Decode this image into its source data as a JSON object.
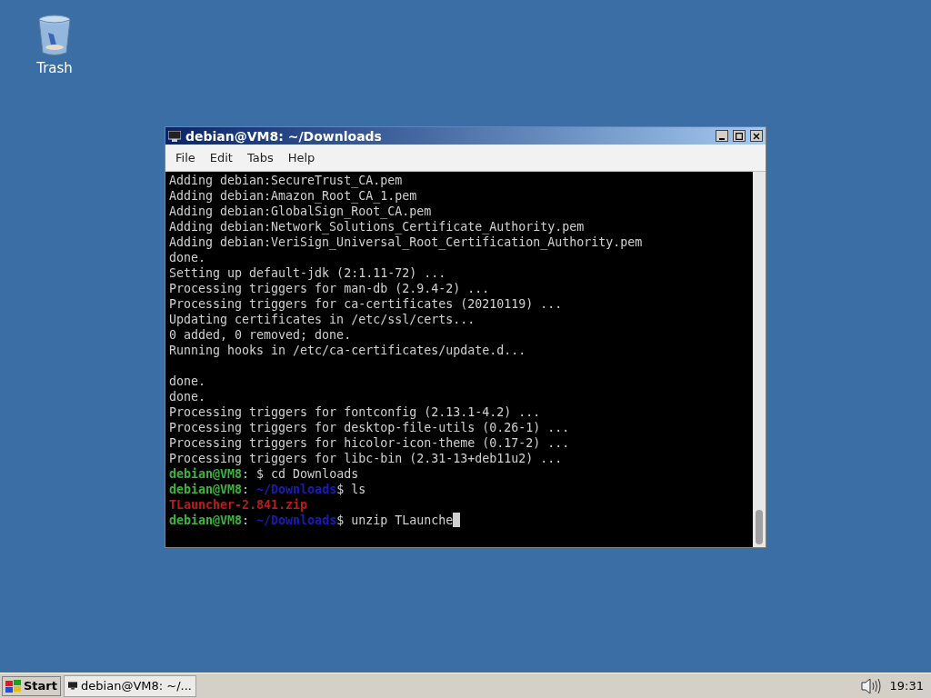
{
  "desktop_icons": [
    {
      "label": "Trash"
    }
  ],
  "window": {
    "title": "debian@VM8: ~/Downloads",
    "menu": [
      "File",
      "Edit",
      "Tabs",
      "Help"
    ]
  },
  "terminal": {
    "lines": [
      [
        {
          "kind": "plain",
          "text": "Adding debian:SecureTrust_CA.pem"
        }
      ],
      [
        {
          "kind": "plain",
          "text": "Adding debian:Amazon_Root_CA_1.pem"
        }
      ],
      [
        {
          "kind": "plain",
          "text": "Adding debian:GlobalSign_Root_CA.pem"
        }
      ],
      [
        {
          "kind": "plain",
          "text": "Adding debian:Network_Solutions_Certificate_Authority.pem"
        }
      ],
      [
        {
          "kind": "plain",
          "text": "Adding debian:VeriSign_Universal_Root_Certification_Authority.pem"
        }
      ],
      [
        {
          "kind": "plain",
          "text": "done."
        }
      ],
      [
        {
          "kind": "plain",
          "text": "Setting up default-jdk (2:1.11-72) ..."
        }
      ],
      [
        {
          "kind": "plain",
          "text": "Processing triggers for man-db (2.9.4-2) ..."
        }
      ],
      [
        {
          "kind": "plain",
          "text": "Processing triggers for ca-certificates (20210119) ..."
        }
      ],
      [
        {
          "kind": "plain",
          "text": "Updating certificates in /etc/ssl/certs..."
        }
      ],
      [
        {
          "kind": "plain",
          "text": "0 added, 0 removed; done."
        }
      ],
      [
        {
          "kind": "plain",
          "text": "Running hooks in /etc/ca-certificates/update.d..."
        }
      ],
      [
        {
          "kind": "blank"
        }
      ],
      [
        {
          "kind": "plain",
          "text": "done."
        }
      ],
      [
        {
          "kind": "plain",
          "text": "done."
        }
      ],
      [
        {
          "kind": "plain",
          "text": "Processing triggers for fontconfig (2.13.1-4.2) ..."
        }
      ],
      [
        {
          "kind": "plain",
          "text": "Processing triggers for desktop-file-utils (0.26-1) ..."
        }
      ],
      [
        {
          "kind": "plain",
          "text": "Processing triggers for hicolor-icon-theme (0.17-2) ..."
        }
      ],
      [
        {
          "kind": "plain",
          "text": "Processing triggers for libc-bin (2.31-13+deb11u2) ..."
        }
      ],
      [
        {
          "kind": "user",
          "text": "debian@VM8"
        },
        {
          "kind": "plain",
          "text": ": $ cd Downloads"
        }
      ],
      [
        {
          "kind": "user",
          "text": "debian@VM8"
        },
        {
          "kind": "plain",
          "text": ": "
        },
        {
          "kind": "path",
          "text": "~/Downloads"
        },
        {
          "kind": "plain",
          "text": "$ ls"
        }
      ],
      [
        {
          "kind": "error",
          "text": "TLauncher-2.841.zip"
        }
      ],
      [
        {
          "kind": "user",
          "text": "debian@VM8"
        },
        {
          "kind": "plain",
          "text": ": "
        },
        {
          "kind": "path",
          "text": "~/Downloads"
        },
        {
          "kind": "plain",
          "text": "$ unzip TLaunche"
        }
      ]
    ],
    "cursor": true
  },
  "taskbar": {
    "start": "Start",
    "tasks": [
      {
        "label": "debian@VM8: ~/...",
        "selected": false
      }
    ],
    "clock": "19:31"
  }
}
